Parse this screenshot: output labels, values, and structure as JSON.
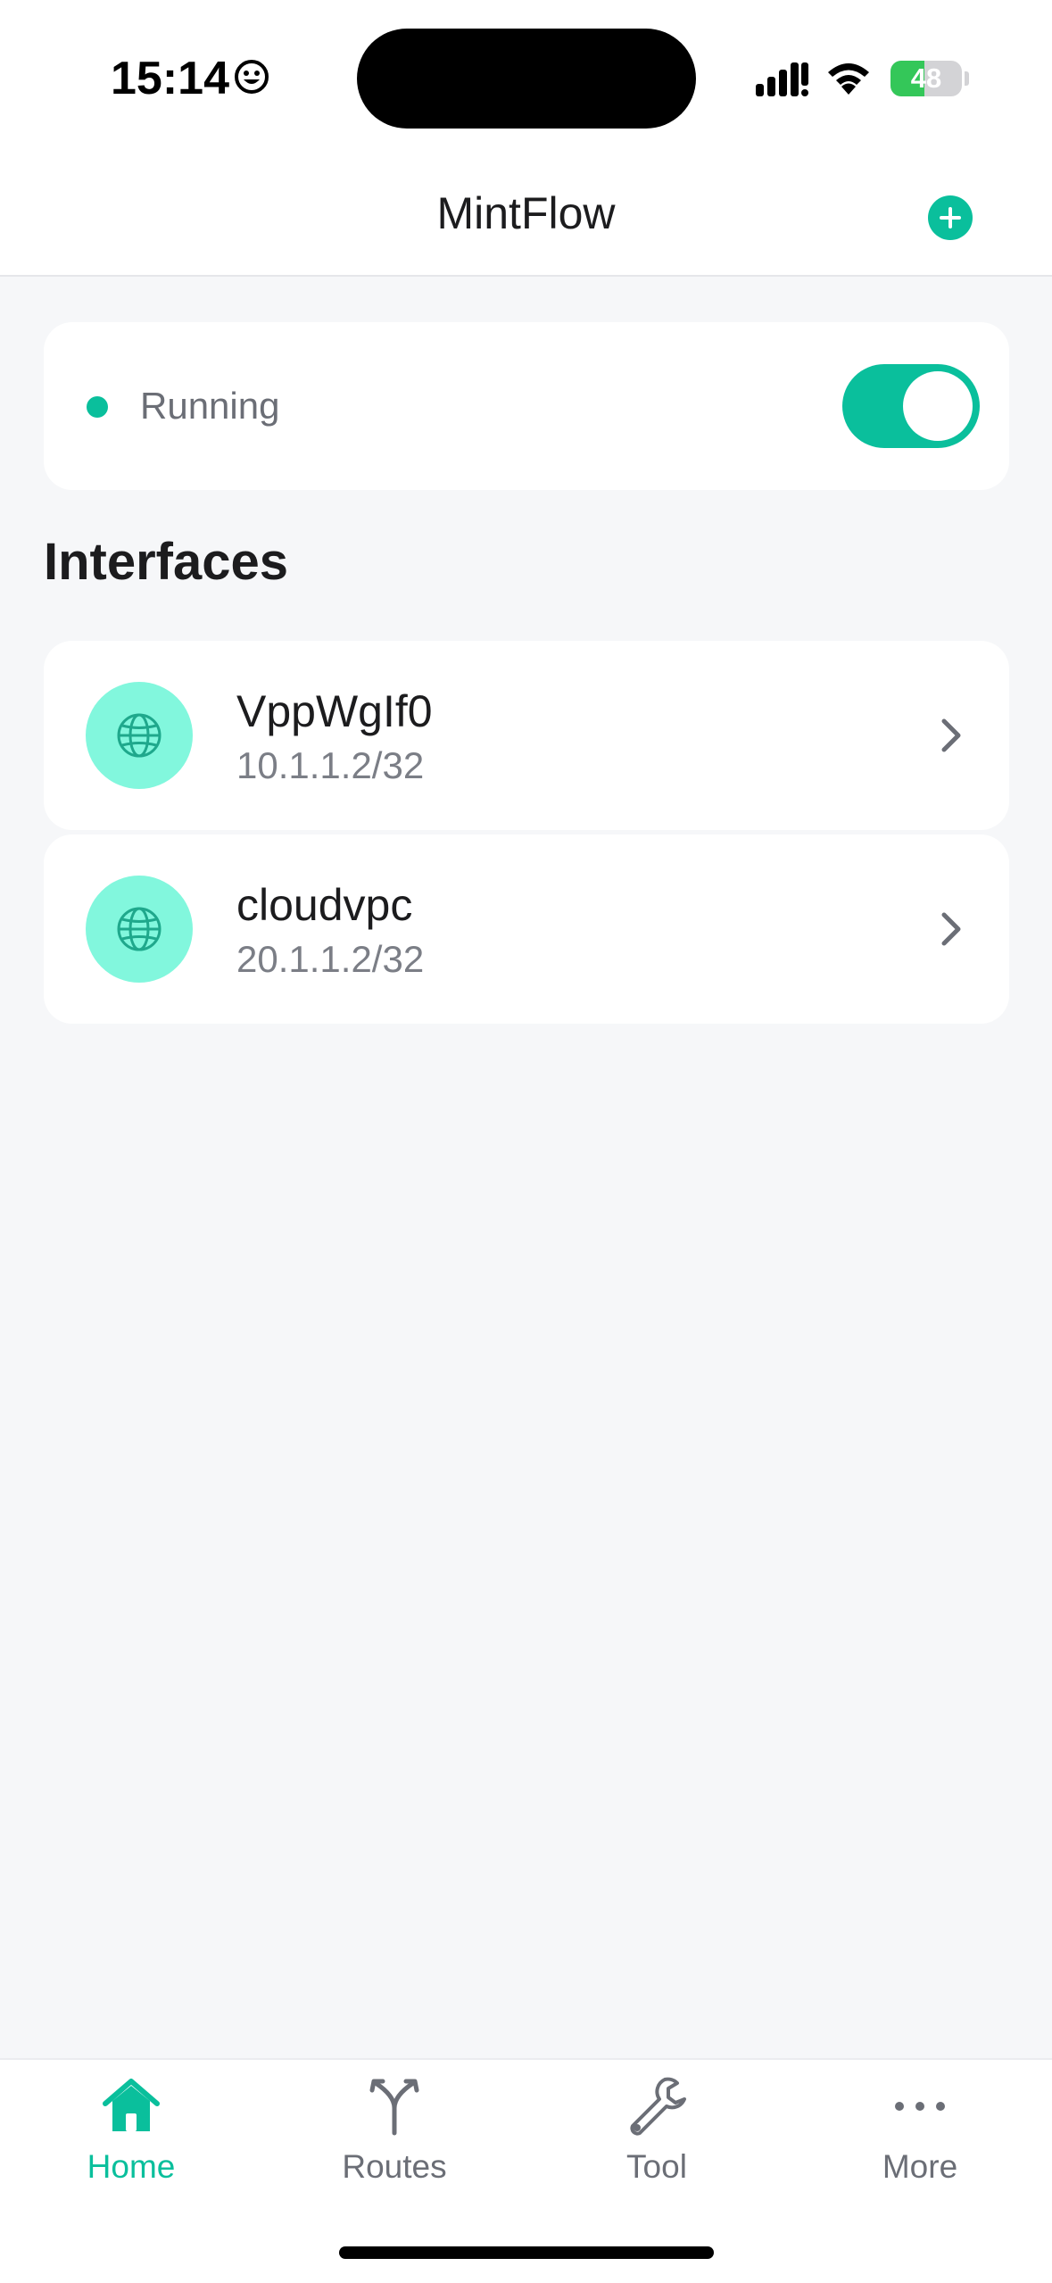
{
  "status_bar": {
    "time": "15:14",
    "battery_percent": 48,
    "battery_label": "48"
  },
  "header": {
    "title": "MintFlow"
  },
  "service": {
    "status_label": "Running",
    "enabled": true
  },
  "interfaces_section": {
    "title": "Interfaces",
    "items": [
      {
        "name": "VppWgIf0",
        "address": "10.1.1.2/32"
      },
      {
        "name": "cloudvpc",
        "address": "20.1.1.2/32"
      }
    ]
  },
  "tab_bar": {
    "active": "Home",
    "tabs": [
      {
        "label": "Home",
        "icon": "home-icon"
      },
      {
        "label": "Routes",
        "icon": "routes-icon"
      },
      {
        "label": "Tool",
        "icon": "wrench-icon"
      },
      {
        "label": "More",
        "icon": "more-icon"
      }
    ]
  },
  "colors": {
    "accent": "#0abf9c",
    "avatar_bg": "#82f7dd",
    "background": "#f6f7f9"
  }
}
